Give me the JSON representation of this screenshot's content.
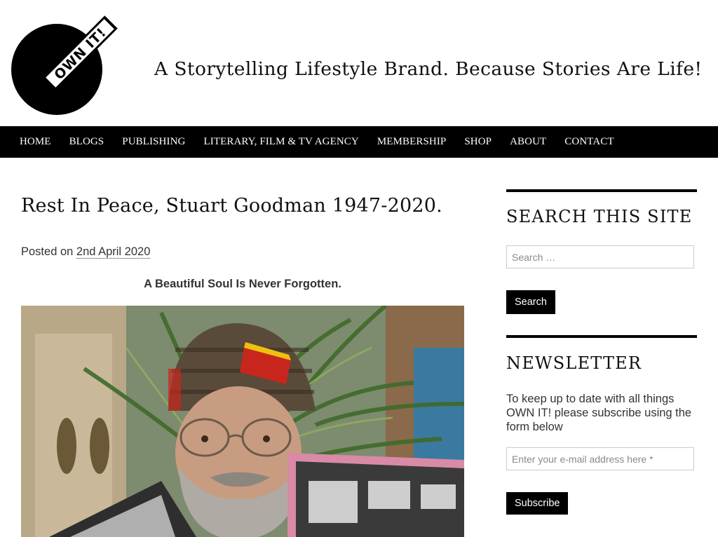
{
  "logo": {
    "text": "OWN IT!",
    "icon": "own-it-logo-icon"
  },
  "tagline": "A Storytelling Lifestyle Brand.  Because Stories Are Life!",
  "nav": {
    "items": [
      {
        "label": "HOME"
      },
      {
        "label": "BLOGS"
      },
      {
        "label": "PUBLISHING"
      },
      {
        "label": "LITERARY, FILM & TV AGENCY"
      },
      {
        "label": "MEMBERSHIP"
      },
      {
        "label": "SHOP"
      },
      {
        "label": "ABOUT"
      },
      {
        "label": "CONTACT"
      }
    ]
  },
  "post": {
    "title": "Rest In Peace, Stuart Goodman 1947-2020.",
    "posted_prefix": "Posted on ",
    "date": "2nd April 2020",
    "subheading": "A Beautiful Soul Is Never Forgotten.",
    "image_alt": "Photo of a smiling bearded man in a knitted hat holding record sleeves"
  },
  "sidebar": {
    "search": {
      "title": "SEARCH THIS SITE",
      "placeholder": "Search …",
      "button": "Search"
    },
    "newsletter": {
      "title": "NEWSLETTER",
      "text": "To keep up to date with all things OWN IT! please subscribe using the form below",
      "placeholder": "Enter your e-mail address here *",
      "button": "Subscribe"
    }
  },
  "colors": {
    "nav_bg": "#000000",
    "nav_text": "#ffffff",
    "button_bg": "#000000"
  }
}
